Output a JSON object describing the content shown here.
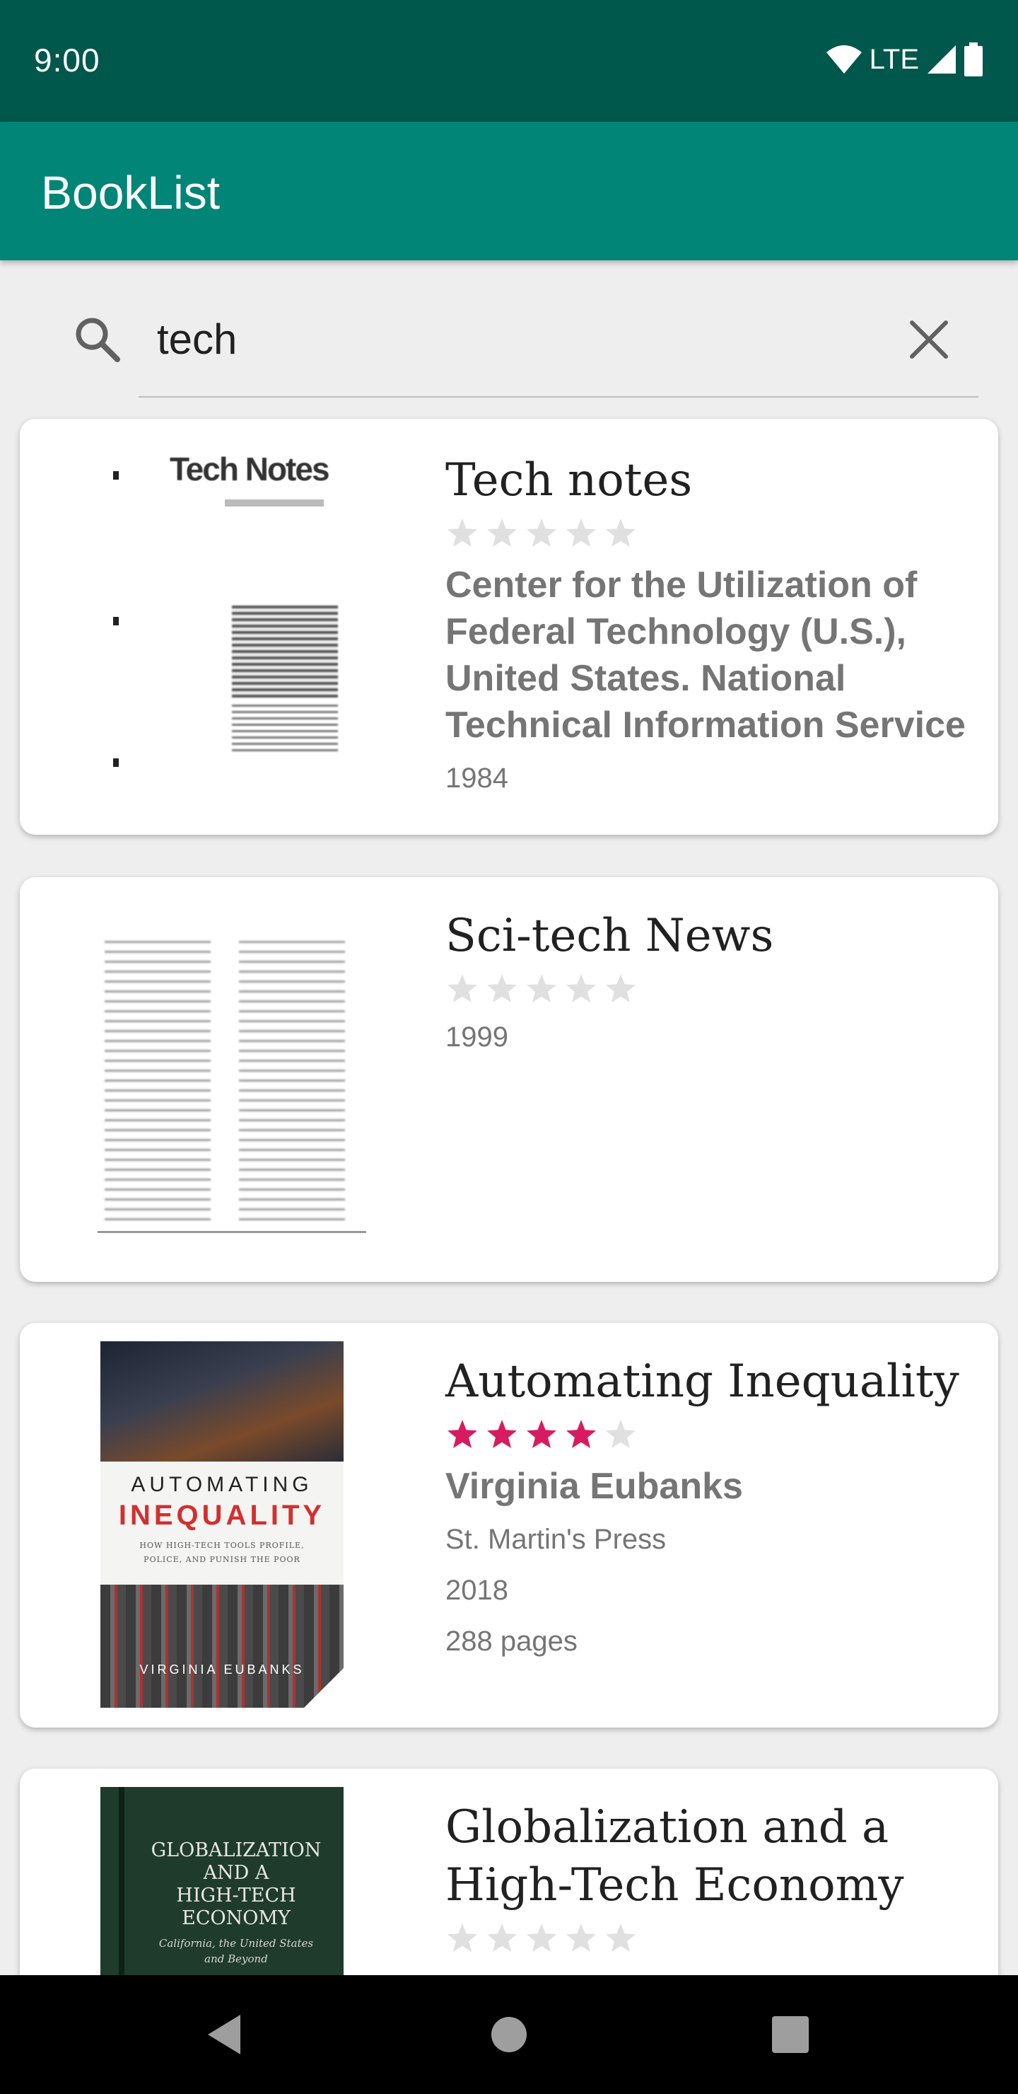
{
  "status_bar": {
    "time": "9:00",
    "network": "LTE"
  },
  "app_bar": {
    "title": "BookList"
  },
  "search": {
    "query": "tech",
    "search_icon": "search-icon",
    "clear_icon": "close-icon"
  },
  "books": [
    {
      "title": "Tech notes",
      "rating": 0,
      "rating_max": 5,
      "author": "Center for the Utilization of Federal Technology (U.S.), United States. National Technical Information Service",
      "year": "1984",
      "cover_text": "Tech Notes"
    },
    {
      "title": "Sci-tech News",
      "rating": 0,
      "rating_max": 5,
      "year": "1999"
    },
    {
      "title": "Automating Inequality",
      "rating": 4,
      "rating_max": 5,
      "author": "Virginia Eubanks",
      "publisher": "St. Martin's Press",
      "year": "2018",
      "pages": "288 pages",
      "cover_text": {
        "line1": "AUTOMATING",
        "line2": "INEQUALITY",
        "subtitle1": "HOW HIGH-TECH TOOLS PROFILE,",
        "subtitle2": "POLICE, AND PUNISH THE POOR",
        "author": "VIRGINIA EUBANKS"
      }
    },
    {
      "title": "Globalization and a High-Tech Economy",
      "rating": 0,
      "rating_max": 5,
      "cover_text": {
        "line1": "GLOBALIZATION",
        "line2": "AND A",
        "line3": "HIGH-TECH",
        "line4": "ECONOMY",
        "subtitle1": "California, the United States",
        "subtitle2": "and Beyond"
      }
    }
  ],
  "colors": {
    "status_bar": "#00574b",
    "app_bar": "#008577",
    "star_filled": "#d81b60",
    "star_empty": "#e0e0e0"
  },
  "nav": {
    "back_icon": "back-triangle-icon",
    "home_icon": "home-circle-icon",
    "recents_icon": "recents-square-icon"
  }
}
